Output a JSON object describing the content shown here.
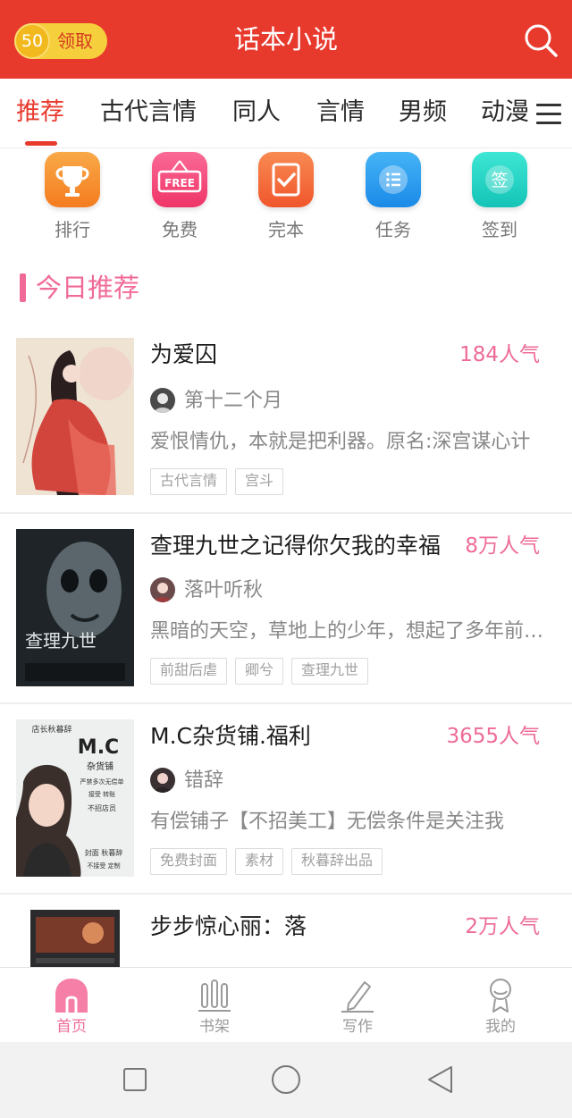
{
  "header": {
    "coin_amount": "50",
    "claim_label": "领取",
    "title": "话本小说"
  },
  "tabs": [
    {
      "label": "推荐",
      "active": true
    },
    {
      "label": "古代言情"
    },
    {
      "label": "同人"
    },
    {
      "label": "言情"
    },
    {
      "label": "男频"
    },
    {
      "label": "动漫"
    }
  ],
  "quick_menu": [
    {
      "label": "排行",
      "icon": "trophy-icon",
      "color": "#f7922c"
    },
    {
      "label": "免费",
      "icon": "free-sign-icon",
      "color": "#f5487a",
      "icon_text": "FREE"
    },
    {
      "label": "完本",
      "icon": "completed-check-icon",
      "color": "#f36b3b"
    },
    {
      "label": "任务",
      "icon": "task-list-icon",
      "color": "#2b9ff0"
    },
    {
      "label": "签到",
      "icon": "sign-in-icon",
      "color": "#23d6c4",
      "icon_text": "签"
    }
  ],
  "section": {
    "title": "今日推荐"
  },
  "books": [
    {
      "title": "为爱囚",
      "popularity": "184人气",
      "author": "第十二个月",
      "description": "爱恨情仇，本就是把利器。原名:深宫谋心计",
      "tags": [
        "古代言情",
        "宫斗"
      ]
    },
    {
      "title": "查理九世之记得你欠我的幸福",
      "popularity": "8万人气",
      "author": "落叶听秋",
      "description": "黑暗的天空，草地上的少年，想起了多年前的约定",
      "tags": [
        "前甜后虐",
        "卿兮",
        "查理九世"
      ],
      "cover_text": "查理九世"
    },
    {
      "title": "M.C杂货铺.福利",
      "popularity": "3655人气",
      "author": "错辞",
      "description": "有偿铺子【不招美工】无偿条件是关注我",
      "tags": [
        "免费封面",
        "素材",
        "秋暮辞出品"
      ],
      "cover_text": {
        "line1": "店长秋暮辞",
        "line2": "M.C",
        "line3": "杂货铺",
        "line4": "严禁多次无偿单",
        "line5": "接受 转账",
        "line6": "不招店员",
        "line7": "封面 秋暮辞",
        "line8": "不接受 定制"
      }
    },
    {
      "title": "步步惊心丽：落",
      "popularity": "2万人气"
    }
  ],
  "bottom_nav": [
    {
      "label": "首页",
      "icon": "home-icon",
      "active": true
    },
    {
      "label": "书架",
      "icon": "bookshelf-icon"
    },
    {
      "label": "写作",
      "icon": "pen-icon"
    },
    {
      "label": "我的",
      "icon": "profile-icon"
    }
  ],
  "colors": {
    "header_red": "#e8392d",
    "accent_pink": "#ee6b97",
    "coin_gold": "#f6cf3d"
  }
}
